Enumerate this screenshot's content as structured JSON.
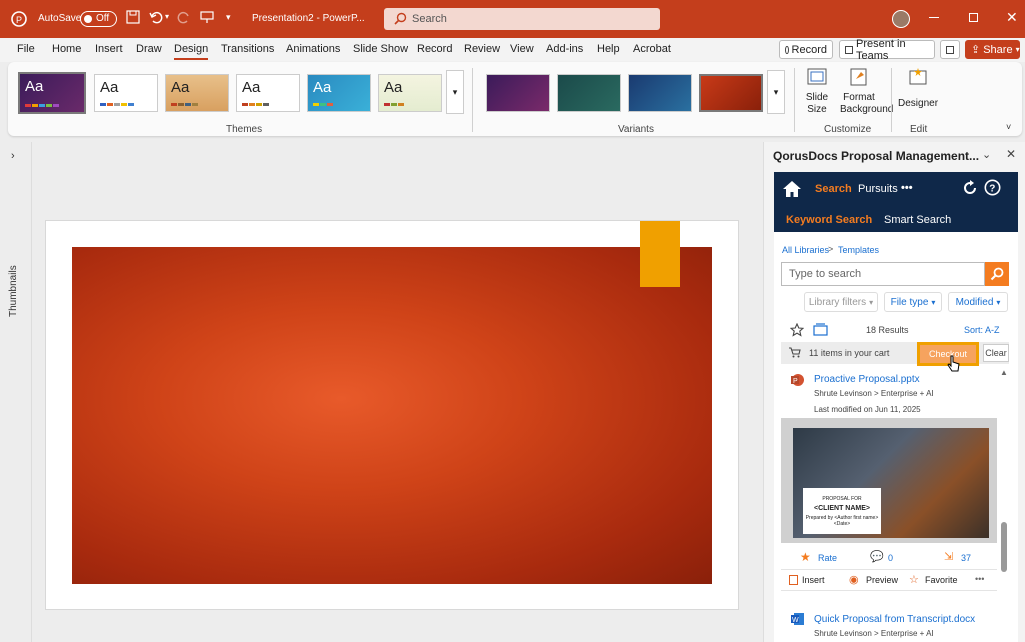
{
  "titlebar": {
    "autosave_label": "AutoSave",
    "autosave_state": "Off",
    "doc_title": "Presentation2 - PowerP...",
    "search_placeholder": "Search"
  },
  "menu": [
    "File",
    "Home",
    "Insert",
    "Draw",
    "Design",
    "Transitions",
    "Animations",
    "Slide Show",
    "Record",
    "Review",
    "View",
    "Add-ins",
    "Help",
    "Acrobat"
  ],
  "active_menu": "Design",
  "top_buttons": {
    "record": "Record",
    "present": "Present in Teams",
    "share": "Share"
  },
  "ribbon": {
    "themes_label": "Themes",
    "variants_label": "Variants",
    "customize_label": "Customize",
    "edit_label": "Edit",
    "theme_aa": "Aa",
    "slide_size": "Slide Size",
    "format_bg_1": "Format",
    "format_bg_2": "Background",
    "designer": "Designer"
  },
  "thumbnails_label": "Thumbnails",
  "pane": {
    "title": "QorusDocs Proposal Management...",
    "nav_search": "Search",
    "nav_pursuits": "Pursuits",
    "nav_more": "•••",
    "tab_keyword": "Keyword Search",
    "tab_smart": "Smart Search",
    "crumb_root": "All Libraries",
    "crumb_sep": ">",
    "crumb_current": "Templates",
    "search_placeholder": "Type to search",
    "filter_library": "Library filters",
    "filter_filetype": "File type",
    "filter_modified": "Modified",
    "results": "18 Results",
    "sort": "Sort: A-Z",
    "cart_text": "11 items in your cart",
    "checkout": "Checkout",
    "clear": "Clear",
    "item1": {
      "name": "Proactive Proposal.pptx",
      "path": "Shrute Levinson > Enterprise + AI",
      "modified": "Last modified on Jun 11, 2025",
      "card_small": "PROPOSAL FOR",
      "card_name": "<CLIENT NAME>",
      "card_footer_1": "Prepared by <Author first name>",
      "card_footer_2": "<Date>",
      "rate": "Rate",
      "comments": "0",
      "uses": "37",
      "insert": "Insert",
      "preview": "Preview",
      "favorite": "Favorite"
    },
    "item2": {
      "name": "Quick Proposal from Transcript.docx",
      "path": "Shrute Levinson > Enterprise + AI"
    }
  },
  "colors": {
    "brand": "#c43e1c",
    "q_navy": "#0f2849",
    "q_orange": "#f47c20",
    "highlight": "#f0a000"
  }
}
